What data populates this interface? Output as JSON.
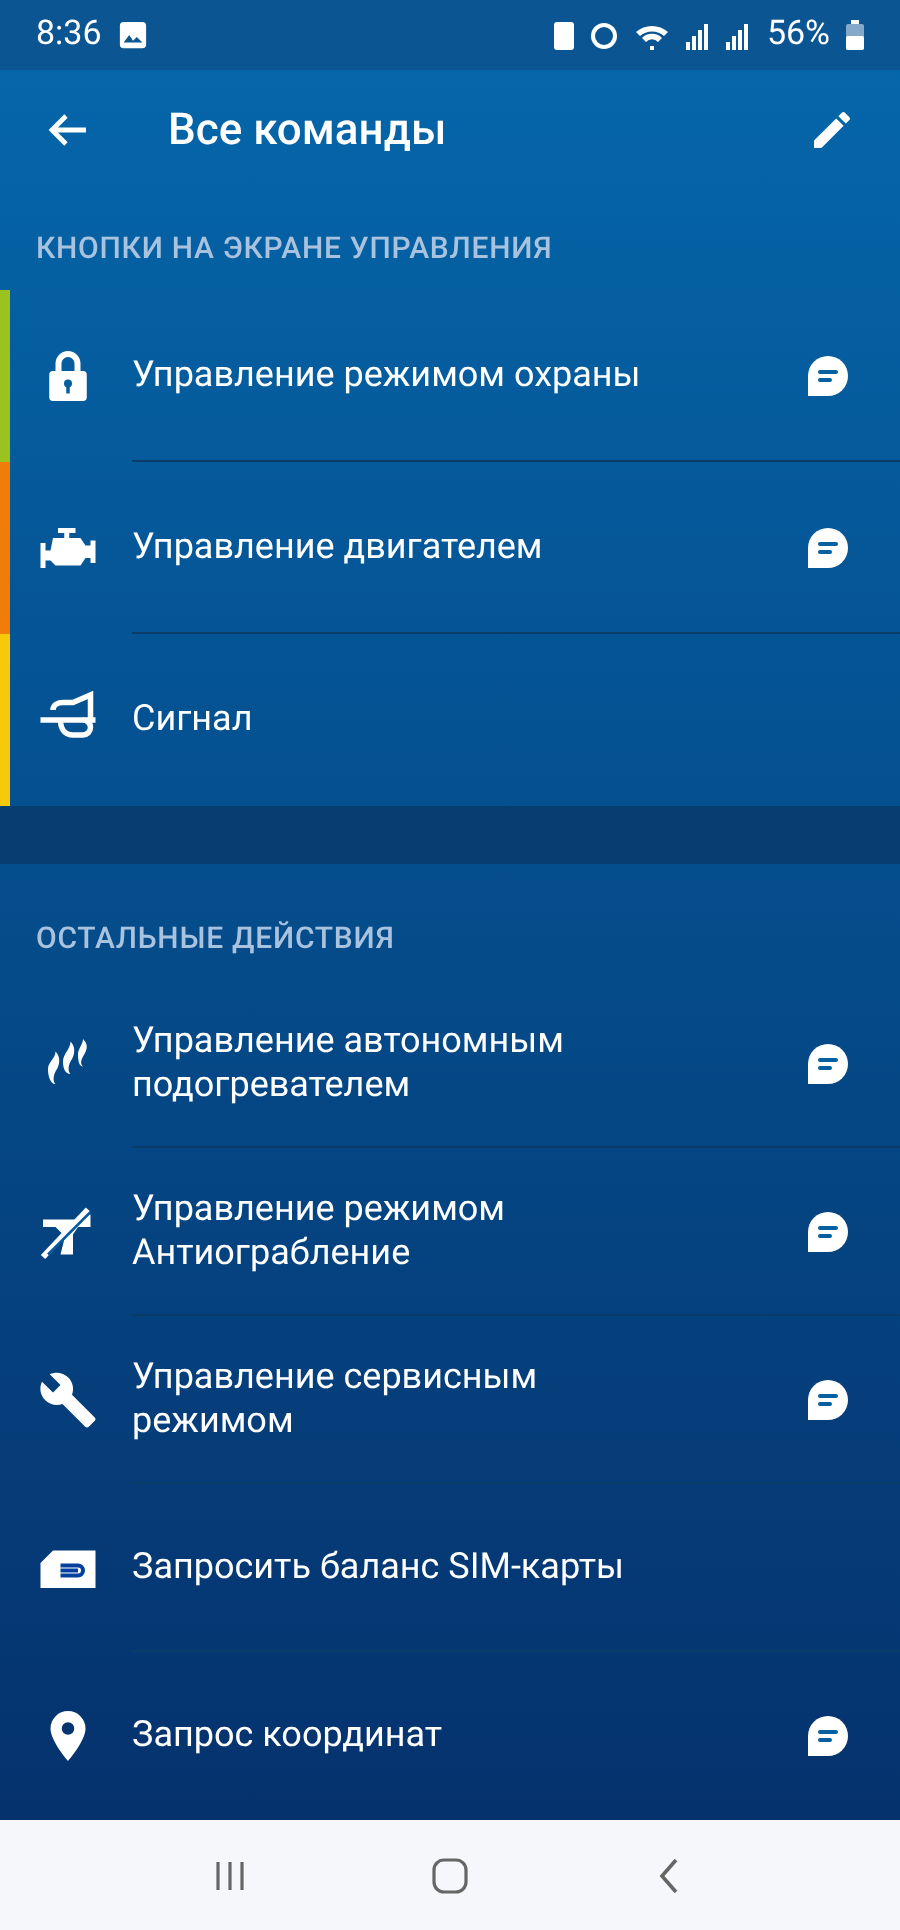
{
  "status_bar": {
    "time": "8:36",
    "battery": "56%"
  },
  "header": {
    "title": "Все команды"
  },
  "sections": [
    {
      "title": "КНОПКИ НА ЭКРАНЕ УПРАВЛЕНИЯ",
      "items": [
        {
          "kind": "lock",
          "label": "Управление режимом охраны",
          "color": "#9bc320",
          "sms": true
        },
        {
          "kind": "engine",
          "label": "Управление двигателем",
          "color": "#f07d0a",
          "sms": true
        },
        {
          "kind": "horn",
          "label": "Сигнал",
          "color": "#f7c90a",
          "sms": false
        }
      ]
    },
    {
      "title": "ОСТАЛЬНЫЕ ДЕЙСТВИЯ",
      "items": [
        {
          "kind": "flame",
          "label": "Управление автономным подогревателем",
          "sms": true
        },
        {
          "kind": "nogun",
          "label": "Управление режимом Антиограбление",
          "sms": true
        },
        {
          "kind": "wrench",
          "label": "Управление сервисным режимом",
          "sms": true
        },
        {
          "kind": "sim",
          "label": "Запросить баланс SIM-карты",
          "sms": false
        },
        {
          "kind": "pin",
          "label": "Запрос координат",
          "sms": true
        }
      ]
    }
  ]
}
